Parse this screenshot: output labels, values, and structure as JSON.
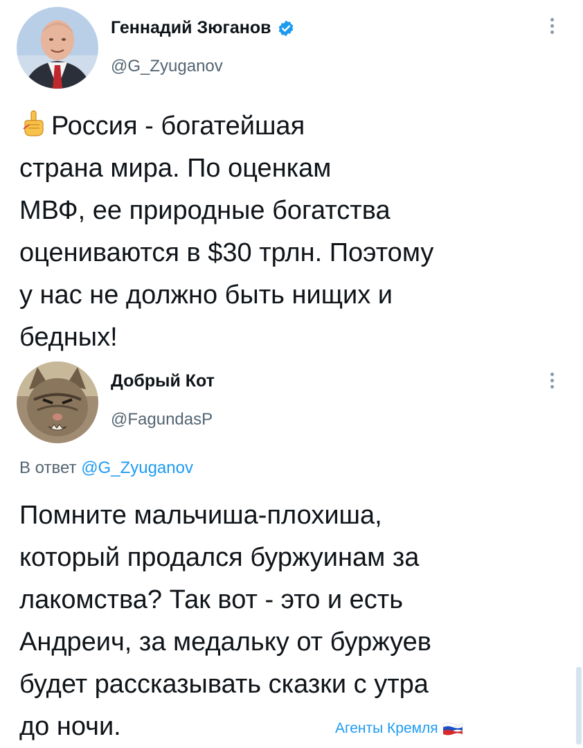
{
  "tweet1": {
    "display_name": "Геннадий Зюганов",
    "handle": "@G_Zyuganov",
    "verified": true,
    "avatar_icon": "person-avatar-icon",
    "text_after_icon": "Россия - богатейшая",
    "text_lines": [
      "страна мира. По оценкам",
      "МВФ, ее природные богатства",
      "оцениваются в $30 трлн. Поэтому",
      "у нас не должно быть нищих и",
      "бедных!"
    ],
    "leading_icon": "pointing-finger-icon"
  },
  "tweet2": {
    "display_name": "Добрый Кот",
    "handle": "@FagundasP",
    "avatar_icon": "cat-avatar-icon",
    "reply_prefix": "В ответ",
    "reply_mention": "@G_Zyuganov",
    "text_lines": [
      "Помните мальчиша-плохиша,",
      "который продался буржуинам за",
      "лакомства? Так вот - это и есть",
      "Андреич, за медальку от буржуев",
      "будет рассказывать сказки с утра",
      "до ночи."
    ]
  },
  "watermark": {
    "text": "Агенты Кремля",
    "icon": "russian-flag-icon"
  },
  "colors": {
    "text": "#0f1419",
    "secondary": "#536471",
    "link": "#1d9bf0",
    "verified": "#1d9bf0"
  }
}
